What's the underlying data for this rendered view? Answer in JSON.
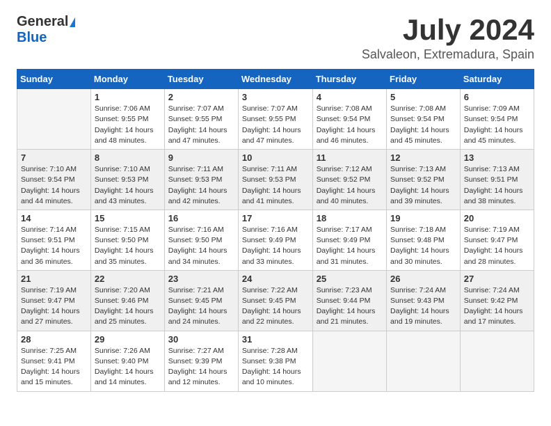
{
  "header": {
    "logo_general": "General",
    "logo_blue": "Blue",
    "month_title": "July 2024",
    "location": "Salvaleon, Extremadura, Spain"
  },
  "weekdays": [
    "Sunday",
    "Monday",
    "Tuesday",
    "Wednesday",
    "Thursday",
    "Friday",
    "Saturday"
  ],
  "weeks": [
    [
      {
        "day": "",
        "sunrise": "",
        "sunset": "",
        "daylight": ""
      },
      {
        "day": "1",
        "sunrise": "7:06 AM",
        "sunset": "9:55 PM",
        "daylight": "14 hours and 48 minutes."
      },
      {
        "day": "2",
        "sunrise": "7:07 AM",
        "sunset": "9:55 PM",
        "daylight": "14 hours and 47 minutes."
      },
      {
        "day": "3",
        "sunrise": "7:07 AM",
        "sunset": "9:55 PM",
        "daylight": "14 hours and 47 minutes."
      },
      {
        "day": "4",
        "sunrise": "7:08 AM",
        "sunset": "9:54 PM",
        "daylight": "14 hours and 46 minutes."
      },
      {
        "day": "5",
        "sunrise": "7:08 AM",
        "sunset": "9:54 PM",
        "daylight": "14 hours and 45 minutes."
      },
      {
        "day": "6",
        "sunrise": "7:09 AM",
        "sunset": "9:54 PM",
        "daylight": "14 hours and 45 minutes."
      }
    ],
    [
      {
        "day": "7",
        "sunrise": "7:10 AM",
        "sunset": "9:54 PM",
        "daylight": "14 hours and 44 minutes."
      },
      {
        "day": "8",
        "sunrise": "7:10 AM",
        "sunset": "9:53 PM",
        "daylight": "14 hours and 43 minutes."
      },
      {
        "day": "9",
        "sunrise": "7:11 AM",
        "sunset": "9:53 PM",
        "daylight": "14 hours and 42 minutes."
      },
      {
        "day": "10",
        "sunrise": "7:11 AM",
        "sunset": "9:53 PM",
        "daylight": "14 hours and 41 minutes."
      },
      {
        "day": "11",
        "sunrise": "7:12 AM",
        "sunset": "9:52 PM",
        "daylight": "14 hours and 40 minutes."
      },
      {
        "day": "12",
        "sunrise": "7:13 AM",
        "sunset": "9:52 PM",
        "daylight": "14 hours and 39 minutes."
      },
      {
        "day": "13",
        "sunrise": "7:13 AM",
        "sunset": "9:51 PM",
        "daylight": "14 hours and 38 minutes."
      }
    ],
    [
      {
        "day": "14",
        "sunrise": "7:14 AM",
        "sunset": "9:51 PM",
        "daylight": "14 hours and 36 minutes."
      },
      {
        "day": "15",
        "sunrise": "7:15 AM",
        "sunset": "9:50 PM",
        "daylight": "14 hours and 35 minutes."
      },
      {
        "day": "16",
        "sunrise": "7:16 AM",
        "sunset": "9:50 PM",
        "daylight": "14 hours and 34 minutes."
      },
      {
        "day": "17",
        "sunrise": "7:16 AM",
        "sunset": "9:49 PM",
        "daylight": "14 hours and 33 minutes."
      },
      {
        "day": "18",
        "sunrise": "7:17 AM",
        "sunset": "9:49 PM",
        "daylight": "14 hours and 31 minutes."
      },
      {
        "day": "19",
        "sunrise": "7:18 AM",
        "sunset": "9:48 PM",
        "daylight": "14 hours and 30 minutes."
      },
      {
        "day": "20",
        "sunrise": "7:19 AM",
        "sunset": "9:47 PM",
        "daylight": "14 hours and 28 minutes."
      }
    ],
    [
      {
        "day": "21",
        "sunrise": "7:19 AM",
        "sunset": "9:47 PM",
        "daylight": "14 hours and 27 minutes."
      },
      {
        "day": "22",
        "sunrise": "7:20 AM",
        "sunset": "9:46 PM",
        "daylight": "14 hours and 25 minutes."
      },
      {
        "day": "23",
        "sunrise": "7:21 AM",
        "sunset": "9:45 PM",
        "daylight": "14 hours and 24 minutes."
      },
      {
        "day": "24",
        "sunrise": "7:22 AM",
        "sunset": "9:45 PM",
        "daylight": "14 hours and 22 minutes."
      },
      {
        "day": "25",
        "sunrise": "7:23 AM",
        "sunset": "9:44 PM",
        "daylight": "14 hours and 21 minutes."
      },
      {
        "day": "26",
        "sunrise": "7:24 AM",
        "sunset": "9:43 PM",
        "daylight": "14 hours and 19 minutes."
      },
      {
        "day": "27",
        "sunrise": "7:24 AM",
        "sunset": "9:42 PM",
        "daylight": "14 hours and 17 minutes."
      }
    ],
    [
      {
        "day": "28",
        "sunrise": "7:25 AM",
        "sunset": "9:41 PM",
        "daylight": "14 hours and 15 minutes."
      },
      {
        "day": "29",
        "sunrise": "7:26 AM",
        "sunset": "9:40 PM",
        "daylight": "14 hours and 14 minutes."
      },
      {
        "day": "30",
        "sunrise": "7:27 AM",
        "sunset": "9:39 PM",
        "daylight": "14 hours and 12 minutes."
      },
      {
        "day": "31",
        "sunrise": "7:28 AM",
        "sunset": "9:38 PM",
        "daylight": "14 hours and 10 minutes."
      },
      {
        "day": "",
        "sunrise": "",
        "sunset": "",
        "daylight": ""
      },
      {
        "day": "",
        "sunrise": "",
        "sunset": "",
        "daylight": ""
      },
      {
        "day": "",
        "sunrise": "",
        "sunset": "",
        "daylight": ""
      }
    ]
  ]
}
